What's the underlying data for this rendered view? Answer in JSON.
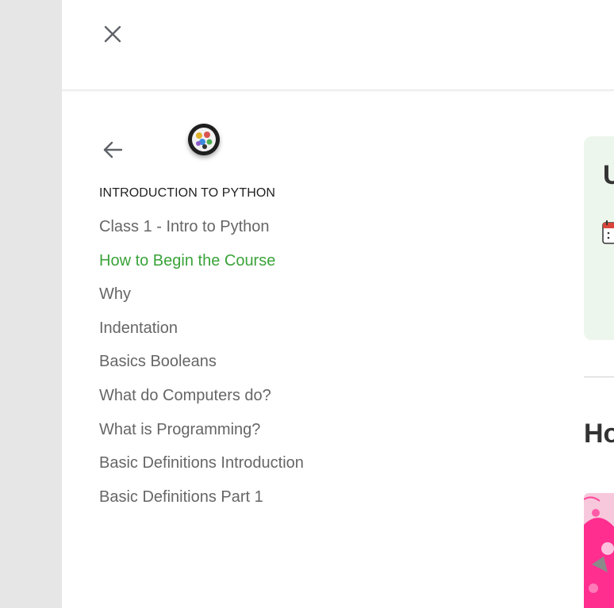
{
  "header": {
    "close_icon": "close-icon"
  },
  "nav": {
    "back_icon": "arrow-left-icon",
    "avatar_icon": "course-avatar-icon"
  },
  "section": {
    "title": "INTRODUCTION TO PYTHON",
    "lessons": [
      {
        "label": "Class 1 - Intro to Python",
        "active": false
      },
      {
        "label": "How to Begin the Course",
        "active": true
      },
      {
        "label": "Why",
        "active": false
      },
      {
        "label": "Indentation",
        "active": false
      },
      {
        "label": "Basics Booleans",
        "active": false
      },
      {
        "label": "What do Computers do?",
        "active": false
      },
      {
        "label": "What is Programming?",
        "active": false
      },
      {
        "label": "Basic Definitions Introduction",
        "active": false
      },
      {
        "label": "Basic Definitions Part 1",
        "active": false
      }
    ]
  },
  "content": {
    "card_title_partial": "U",
    "heading_partial": "Ho",
    "calendar_icon": "calendar-icon"
  },
  "colors": {
    "active_lesson": "#3aa33a",
    "lesson_text": "#666666",
    "card_bg": "#edf6ec"
  }
}
